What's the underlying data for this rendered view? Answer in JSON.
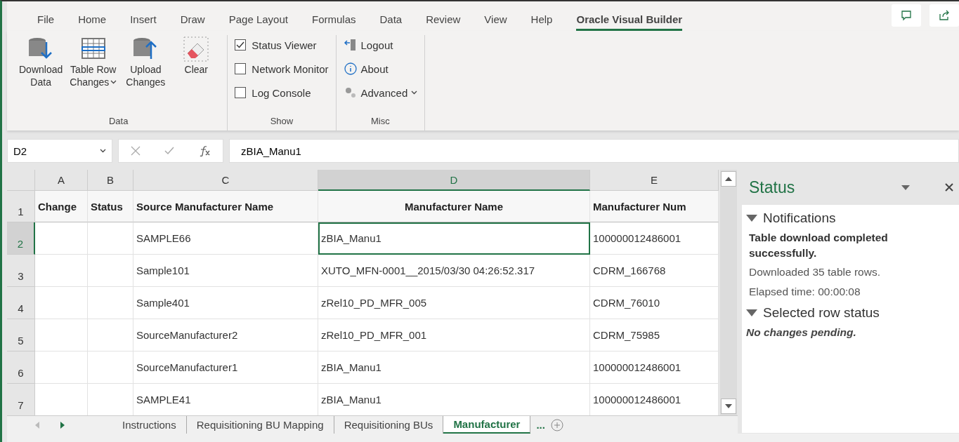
{
  "menu_tabs": [
    {
      "label": "File",
      "selected": false
    },
    {
      "label": "Home",
      "selected": false
    },
    {
      "label": "Insert",
      "selected": false
    },
    {
      "label": "Draw",
      "selected": false
    },
    {
      "label": "Page Layout",
      "selected": false
    },
    {
      "label": "Formulas",
      "selected": false
    },
    {
      "label": "Data",
      "selected": false
    },
    {
      "label": "Review",
      "selected": false
    },
    {
      "label": "View",
      "selected": false
    },
    {
      "label": "Help",
      "selected": false
    },
    {
      "label": "Oracle Visual Builder",
      "selected": true
    }
  ],
  "ribbon": {
    "groups": [
      {
        "label": "Data",
        "kind": "large",
        "items": [
          {
            "kind": "download",
            "lines": [
              "Download",
              "Data"
            ],
            "dropdown": false
          },
          {
            "kind": "table",
            "lines": [
              "Table Row",
              "Changes"
            ],
            "dropdown": true
          },
          {
            "kind": "upload",
            "lines": [
              "Upload",
              "Changes"
            ],
            "dropdown": false
          },
          {
            "kind": "clear",
            "lines": [
              "Clear"
            ],
            "dropdown": false
          }
        ]
      },
      {
        "label": "Show",
        "kind": "checks",
        "items": [
          {
            "label": "Status Viewer",
            "checked": true
          },
          {
            "label": "Network Monitor",
            "checked": false
          },
          {
            "label": "Log Console",
            "checked": false
          }
        ]
      },
      {
        "label": "Misc",
        "kind": "small",
        "items": [
          {
            "kind": "logout",
            "label": "Logout",
            "dropdown": false
          },
          {
            "kind": "about",
            "label": "About",
            "dropdown": false
          },
          {
            "kind": "advanced",
            "label": "Advanced",
            "dropdown": true
          }
        ]
      }
    ]
  },
  "formula_bar": {
    "name_box": "D2",
    "formula": "zBIA_Manu1"
  },
  "sheet": {
    "columns": [
      {
        "label": "A",
        "selected": false
      },
      {
        "label": "B",
        "selected": false
      },
      {
        "label": "C",
        "selected": false
      },
      {
        "label": "D",
        "selected": true
      },
      {
        "label": "E",
        "selected": false
      }
    ],
    "rows": [
      {
        "number": "1",
        "kind": "header",
        "selected": false,
        "cells": [
          "Change",
          "Status",
          "Source Manufacturer Name",
          "Manufacturer Name",
          "Manufacturer Num"
        ]
      },
      {
        "number": "2",
        "kind": "data",
        "selected": true,
        "cells": [
          "",
          "",
          "SAMPLE66",
          "zBIA_Manu1",
          "100000012486001"
        ]
      },
      {
        "number": "3",
        "kind": "data",
        "selected": false,
        "cells": [
          "",
          "",
          "Sample101",
          "XUTO_MFN-0001__2015/03/30 04:26:52.317",
          "CDRM_166768"
        ]
      },
      {
        "number": "4",
        "kind": "data",
        "selected": false,
        "cells": [
          "",
          "",
          "Sample401",
          "zRel10_PD_MFR_005",
          "CDRM_76010"
        ]
      },
      {
        "number": "5",
        "kind": "data",
        "selected": false,
        "cells": [
          "",
          "",
          "SourceManufacturer2",
          "zRel10_PD_MFR_001",
          "CDRM_75985"
        ]
      },
      {
        "number": "6",
        "kind": "data",
        "selected": false,
        "cells": [
          "",
          "",
          "SourceManufacturer1",
          "zBIA_Manu1",
          "100000012486001"
        ]
      },
      {
        "number": "7",
        "kind": "data",
        "selected": false,
        "cells": [
          "",
          "",
          "SAMPLE41",
          "zBIA_Manu1",
          "100000012486001"
        ]
      }
    ]
  },
  "sheet_tabs": [
    {
      "label": "Instructions",
      "selected": false
    },
    {
      "label": "Requisitioning BU Mapping",
      "selected": false
    },
    {
      "label": "Requisitioning BUs",
      "selected": false
    },
    {
      "label": "Manufacturer",
      "selected": true
    }
  ],
  "more_tabs": "...",
  "status_pane": {
    "title": "Status",
    "sections": [
      {
        "title": "Notifications",
        "expanded": true,
        "messages": [
          {
            "kind": "bold",
            "text": "Table download completed successfully."
          },
          {
            "kind": "normal",
            "text": "Downloaded 35 table rows."
          },
          {
            "kind": "normal",
            "text": "Elapsed time: 00:00:08"
          }
        ]
      },
      {
        "title": "Selected row status",
        "expanded": true,
        "messages": [
          {
            "kind": "italic",
            "text": "No changes pending."
          }
        ]
      }
    ]
  }
}
